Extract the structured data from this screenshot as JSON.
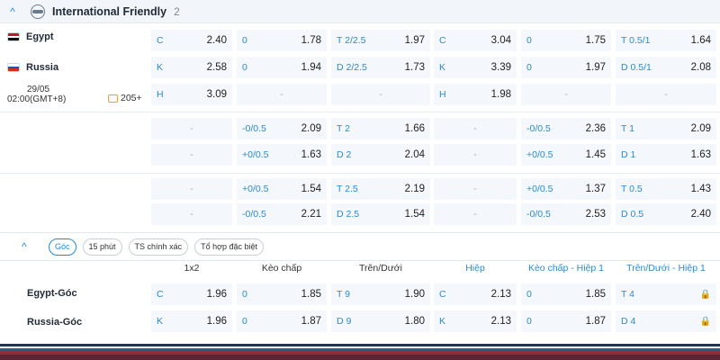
{
  "league": {
    "title": "International Friendly",
    "count": "2",
    "toggle": "^"
  },
  "teams": {
    "home": {
      "name": "Egypt",
      "flag": [
        "#ce1126",
        "#ffffff",
        "#111111"
      ]
    },
    "away": {
      "name": "Russia",
      "flag": [
        "#ffffff",
        "#1c57a7",
        "#d52b1e"
      ]
    }
  },
  "match": {
    "date": "29/05",
    "time": "02:00(GMT+8)",
    "markets": "205+"
  },
  "rows": [
    [
      {
        "l": "C",
        "v": "2.40"
      },
      {
        "l": "0",
        "v": "1.78"
      },
      {
        "l": "T 2/2.5",
        "v": "1.97"
      },
      {
        "l": "C",
        "v": "3.04"
      },
      {
        "l": "0",
        "v": "1.75"
      },
      {
        "l": "T 0.5/1",
        "v": "1.64"
      }
    ],
    [
      {
        "l": "K",
        "v": "2.58"
      },
      {
        "l": "0",
        "v": "1.94"
      },
      {
        "l": "D 2/2.5",
        "v": "1.73"
      },
      {
        "l": "K",
        "v": "3.39"
      },
      {
        "l": "0",
        "v": "1.97"
      },
      {
        "l": "D 0.5/1",
        "v": "2.08"
      }
    ],
    [
      {
        "l": "H",
        "v": "3.09"
      },
      {
        "dash": "-"
      },
      {
        "dash": "-"
      },
      {
        "l": "H",
        "v": "1.98"
      },
      {
        "dash": "-"
      },
      {
        "dash": "-"
      }
    ],
    [
      {
        "dash": "-"
      },
      {
        "l": "-0/0.5",
        "v": "2.09"
      },
      {
        "l": "T 2",
        "v": "1.66"
      },
      {
        "dash": "-"
      },
      {
        "l": "-0/0.5",
        "v": "2.36"
      },
      {
        "l": "T 1",
        "v": "2.09"
      }
    ],
    [
      {
        "dash": "-"
      },
      {
        "l": "+0/0.5",
        "v": "1.63"
      },
      {
        "l": "D 2",
        "v": "2.04"
      },
      {
        "dash": "-"
      },
      {
        "l": "+0/0.5",
        "v": "1.45"
      },
      {
        "l": "D 1",
        "v": "1.63"
      }
    ],
    [
      {
        "dash": "-"
      },
      {
        "l": "+0/0.5",
        "v": "1.54"
      },
      {
        "l": "T 2.5",
        "v": "2.19"
      },
      {
        "dash": "-"
      },
      {
        "l": "+0/0.5",
        "v": "1.37"
      },
      {
        "l": "T 0.5",
        "v": "1.43"
      }
    ],
    [
      {
        "dash": "-"
      },
      {
        "l": "-0/0.5",
        "v": "2.21"
      },
      {
        "l": "D 2.5",
        "v": "1.54"
      },
      {
        "dash": "-"
      },
      {
        "l": "-0/0.5",
        "v": "2.53"
      },
      {
        "l": "D 0.5",
        "v": "2.40"
      }
    ]
  ],
  "corner": {
    "collapse": "^",
    "filters": [
      "Góc",
      "15 phút",
      "TS chính xác",
      "Tổ hợp đặc biệt"
    ],
    "headers": [
      "1x2",
      "Kèo chấp",
      "Trên/Dưới",
      "Hiệp",
      "Kèo chấp - Hiệp 1",
      "Trên/Dưới - Hiệp 1"
    ],
    "teams": [
      "Egypt-Góc",
      "Russia-Góc"
    ],
    "rows": [
      [
        {
          "l": "C",
          "v": "1.96"
        },
        {
          "l": "0",
          "v": "1.85"
        },
        {
          "l": "T 9",
          "v": "1.90"
        },
        {
          "l": "C",
          "v": "2.13"
        },
        {
          "l": "0",
          "v": "1.85"
        },
        {
          "l": "T 4",
          "v": "🔒",
          "lock": true
        }
      ],
      [
        {
          "l": "K",
          "v": "1.96"
        },
        {
          "l": "0",
          "v": "1.87"
        },
        {
          "l": "D 9",
          "v": "1.80"
        },
        {
          "l": "K",
          "v": "2.13"
        },
        {
          "l": "0",
          "v": "1.87"
        },
        {
          "l": "D 4",
          "v": "🔒",
          "lock": true
        }
      ]
    ]
  }
}
